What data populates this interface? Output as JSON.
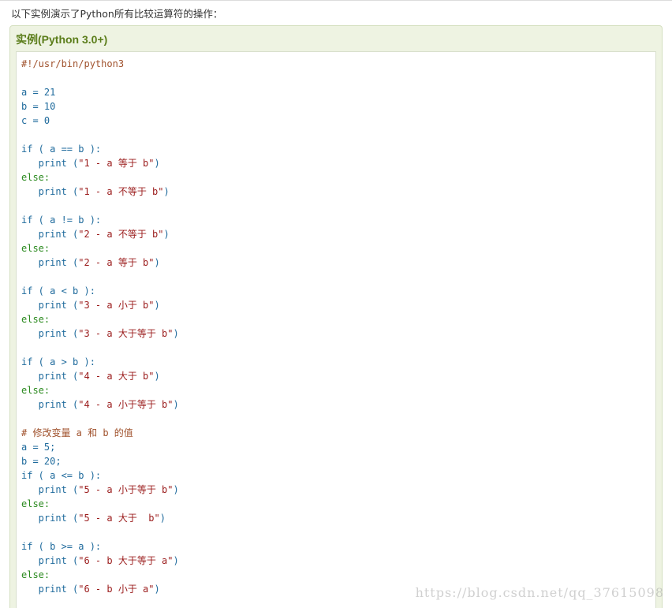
{
  "intro_text": "以下实例演示了Python所有比较运算符的操作：",
  "example": {
    "title": "实例(Python 3.0+)",
    "lines": [
      [
        {
          "t": "#!/usr/bin/python3",
          "c": "comment"
        }
      ],
      [],
      [
        {
          "t": "a = 21",
          "c": "code"
        }
      ],
      [
        {
          "t": "b = 10",
          "c": "code"
        }
      ],
      [
        {
          "t": "c = 0",
          "c": "code"
        }
      ],
      [],
      [
        {
          "t": "if ( a == b ):",
          "c": "code"
        }
      ],
      [
        {
          "t": "   print (",
          "c": "code"
        },
        {
          "t": "\"1 - a 等于 b\"",
          "c": "str"
        },
        {
          "t": ")",
          "c": "code"
        }
      ],
      [
        {
          "t": "else:",
          "c": "kw"
        }
      ],
      [
        {
          "t": "   print (",
          "c": "code"
        },
        {
          "t": "\"1 - a 不等于 b\"",
          "c": "str"
        },
        {
          "t": ")",
          "c": "code"
        }
      ],
      [],
      [
        {
          "t": "if ( a != b ):",
          "c": "code"
        }
      ],
      [
        {
          "t": "   print (",
          "c": "code"
        },
        {
          "t": "\"2 - a 不等于 b\"",
          "c": "str"
        },
        {
          "t": ")",
          "c": "code"
        }
      ],
      [
        {
          "t": "else:",
          "c": "kw"
        }
      ],
      [
        {
          "t": "   print (",
          "c": "code"
        },
        {
          "t": "\"2 - a 等于 b\"",
          "c": "str"
        },
        {
          "t": ")",
          "c": "code"
        }
      ],
      [],
      [
        {
          "t": "if ( a < b ):",
          "c": "code"
        }
      ],
      [
        {
          "t": "   print (",
          "c": "code"
        },
        {
          "t": "\"3 - a 小于 b\"",
          "c": "str"
        },
        {
          "t": ")",
          "c": "code"
        }
      ],
      [
        {
          "t": "else:",
          "c": "kw"
        }
      ],
      [
        {
          "t": "   print (",
          "c": "code"
        },
        {
          "t": "\"3 - a 大于等于 b\"",
          "c": "str"
        },
        {
          "t": ")",
          "c": "code"
        }
      ],
      [],
      [
        {
          "t": "if ( a > b ):",
          "c": "code"
        }
      ],
      [
        {
          "t": "   print (",
          "c": "code"
        },
        {
          "t": "\"4 - a 大于 b\"",
          "c": "str"
        },
        {
          "t": ")",
          "c": "code"
        }
      ],
      [
        {
          "t": "else:",
          "c": "kw"
        }
      ],
      [
        {
          "t": "   print (",
          "c": "code"
        },
        {
          "t": "\"4 - a 小于等于 b\"",
          "c": "str"
        },
        {
          "t": ")",
          "c": "code"
        }
      ],
      [],
      [
        {
          "t": "# 修改变量 a 和 b 的值",
          "c": "comment"
        }
      ],
      [
        {
          "t": "a = 5;",
          "c": "code"
        }
      ],
      [
        {
          "t": "b = 20;",
          "c": "code"
        }
      ],
      [
        {
          "t": "if ( a <= b ):",
          "c": "code"
        }
      ],
      [
        {
          "t": "   print (",
          "c": "code"
        },
        {
          "t": "\"5 - a 小于等于 b\"",
          "c": "str"
        },
        {
          "t": ")",
          "c": "code"
        }
      ],
      [
        {
          "t": "else:",
          "c": "kw"
        }
      ],
      [
        {
          "t": "   print (",
          "c": "code"
        },
        {
          "t": "\"5 - a 大于  b\"",
          "c": "str"
        },
        {
          "t": ")",
          "c": "code"
        }
      ],
      [],
      [
        {
          "t": "if ( b >= a ):",
          "c": "code"
        }
      ],
      [
        {
          "t": "   print (",
          "c": "code"
        },
        {
          "t": "\"6 - b 大于等于 a\"",
          "c": "str"
        },
        {
          "t": ")",
          "c": "code"
        }
      ],
      [
        {
          "t": "else:",
          "c": "kw"
        }
      ],
      [
        {
          "t": "   print (",
          "c": "code"
        },
        {
          "t": "\"6 - b 小于 a\"",
          "c": "str"
        },
        {
          "t": ")",
          "c": "code"
        }
      ]
    ]
  },
  "watermark": "https://blog.csdn.net/qq_37615098",
  "colors": {
    "title_green": "#5b7d1a",
    "box_background": "#eef3e2",
    "comment": "#a0522d",
    "code": "#1e6a9c",
    "keyword": "#2b8a1f",
    "string": "#9b1c1c"
  }
}
